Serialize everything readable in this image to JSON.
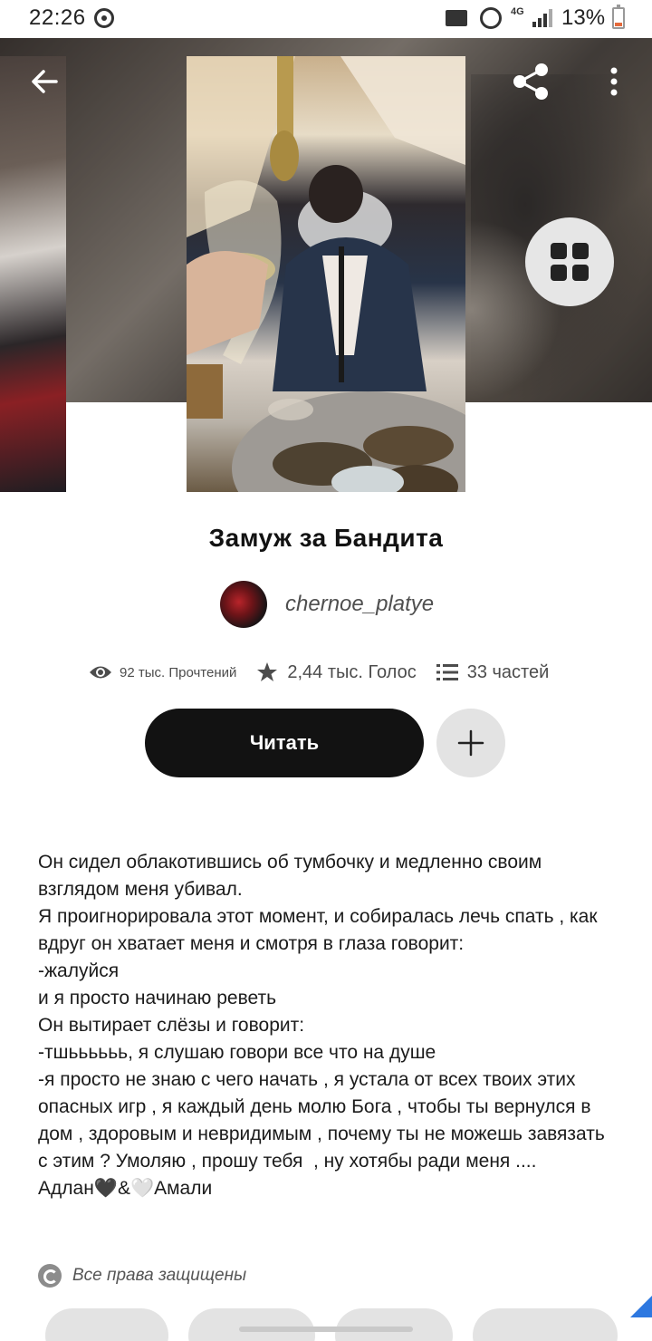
{
  "status_bar": {
    "time": "22:26",
    "network": "4G",
    "battery": "13%"
  },
  "story": {
    "title": "Замуж за Бандита",
    "author": "chernoe_platye"
  },
  "stats": {
    "reads": "92 тыс. Прочтений",
    "votes": "2,44 тыс. Голос",
    "parts": "33 частей"
  },
  "actions": {
    "read_label": "Читать"
  },
  "description": "Он сидел облакотившись об тумбочку и медленно своим взглядом меня убивал.\nЯ проигнорировала этот момент, и собиралась лечь спать , как вдруг он хватает меня и смотря в глаза говорит:\n-жалуйся\nи я просто начинаю реветь\nОн вытирает слёзы и говорит:\n-тшьььььь, я слушаю говори все что на душе\n-я просто не знаю с чего начать , я устала от всех твоих этих опасных игр , я каждый день молю Бога , чтобы ты вернулся в дом , здоровым и невридимым , почему ты не можешь завязать с этим ? Умоляю , прошу тебя  , ну хотябы ради меня ....\nАдлан🖤&🤍Амали",
  "copyright": "Все права защищены",
  "icons": {
    "back": "arrow-left-icon",
    "share": "share-icon",
    "more": "more-vertical-icon",
    "grid": "grid-icon",
    "reads": "eye-icon",
    "votes": "star-icon",
    "parts": "list-icon",
    "add": "plus-icon",
    "copyright": "copyright-icon"
  },
  "colors": {
    "primary_button": "#121212",
    "secondary_button": "#e3e3e3",
    "text_muted": "#4c4c4c"
  }
}
